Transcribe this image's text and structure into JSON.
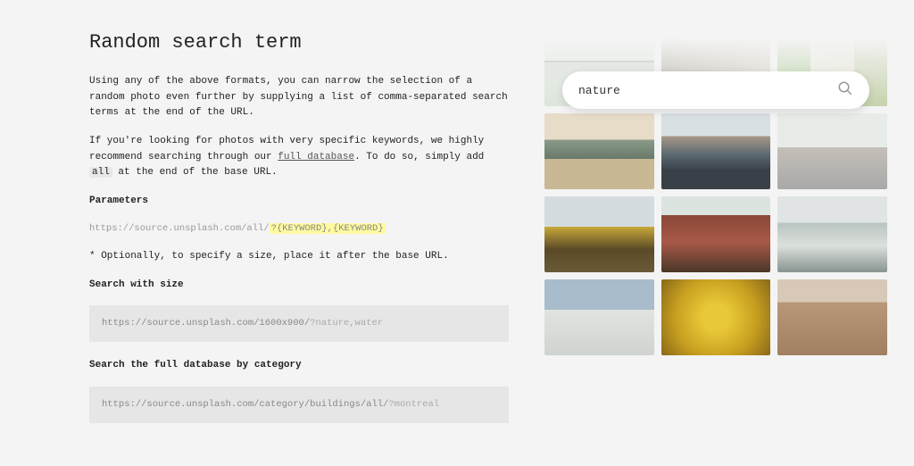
{
  "heading": "Random search term",
  "para1": "Using any of the above formats, you can narrow the selection of a random photo even further by supplying a list of comma-separated search terms at the end of the URL.",
  "para2_a": "If you're looking for photos with very specific keywords, we highly recommend searching through our ",
  "para2_link": "full database",
  "para2_b": ". To do so, simply add ",
  "para2_tag": "all",
  "para2_c": " at the end of the base URL.",
  "params_label": "Parameters",
  "params_url_base": "https://source.unsplash.com/all/",
  "params_url_hl": "?{KEYWORD},{KEYWORD}",
  "optional_note": "* Optionally, to specify a size, place it after the base URL.",
  "size_label": "Search with size",
  "size_url_base": "https://source.unsplash.com/1600x900/",
  "size_url_hl": "?nature,water",
  "fulldb_label": "Search the full database by category",
  "fulldb_url_base": "https://source.unsplash.com/category/buildings/all/",
  "fulldb_url_hl": "?montreal",
  "search_value": "nature"
}
